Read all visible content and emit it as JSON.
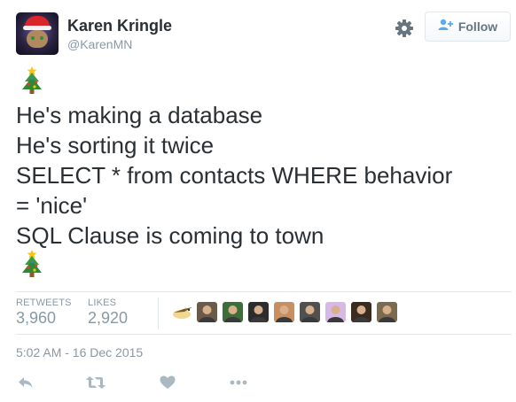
{
  "user": {
    "display_name": "Karen Kringle",
    "username": "@KarenMN",
    "avatar_icon": "cat-santa-hat-avatar"
  },
  "header": {
    "settings_icon": "gear-icon",
    "follow_label": "Follow",
    "follow_icon": "add-person-icon"
  },
  "tweet": {
    "leading_emoji": "christmas-tree-icon",
    "lines": [
      "He's making a database",
      "He's sorting it twice",
      "SELECT * from contacts WHERE behavior",
      "= 'nice'",
      "SQL Clause is coming to town"
    ],
    "trailing_emoji": "christmas-tree-icon"
  },
  "stats": {
    "retweets_label": "RETWEETS",
    "retweets_value": "3,960",
    "likes_label": "LIKES",
    "likes_value": "2,920"
  },
  "facepile": [
    {
      "icon": "bird-avatar",
      "color": "#f0d890"
    },
    {
      "icon": "person-avatar",
      "color": "#6b5a4a"
    },
    {
      "icon": "cartoon-avatar",
      "color": "#3c6e3a"
    },
    {
      "icon": "person-avatar",
      "color": "#2c2c2c"
    },
    {
      "icon": "person-avatar",
      "color": "#c89060"
    },
    {
      "icon": "person-avatar",
      "color": "#505050"
    },
    {
      "icon": "anime-avatar",
      "color": "#d8b8e8"
    },
    {
      "icon": "dog-avatar",
      "color": "#3a2a20"
    },
    {
      "icon": "person-avatar",
      "color": "#7a6a50"
    }
  ],
  "timestamp": "5:02 AM - 16 Dec 2015",
  "actions": {
    "reply_icon": "reply-icon",
    "retweet_icon": "retweet-icon",
    "like_icon": "heart-icon",
    "more_icon": "more-dots-icon"
  },
  "colors": {
    "text": "#292f33",
    "muted": "#8899a6",
    "stat_value": "#8899a6",
    "action_icon": "#aab8c2",
    "divider": "#e1e8ed",
    "follow_blue": "#55acee"
  }
}
